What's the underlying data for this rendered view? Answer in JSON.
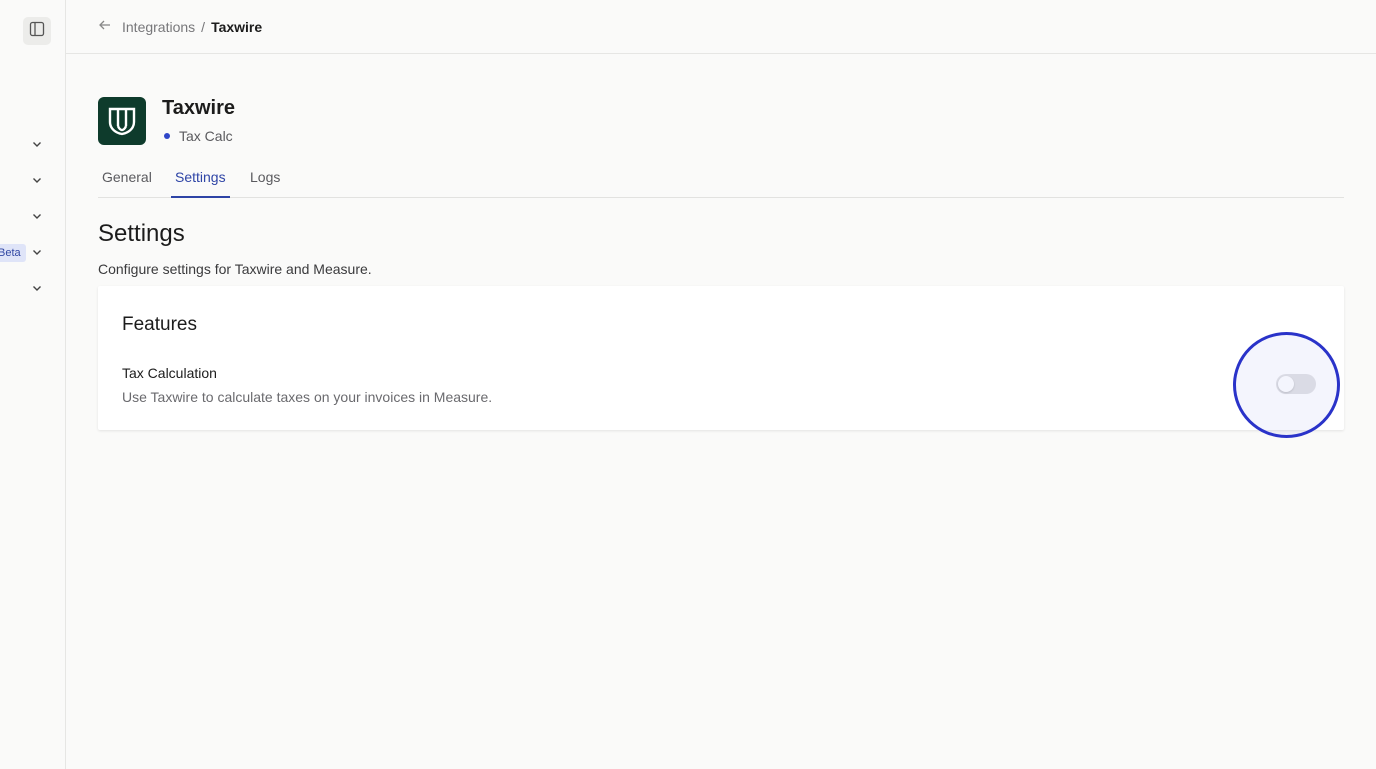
{
  "rail": {
    "toggle_icon": "sidebar-panel-icon",
    "beta_label": "Beta",
    "chevron_icon": "chevron-down-icon"
  },
  "breadcrumb": {
    "back_icon": "arrow-left-icon",
    "parent": "Integrations",
    "separator": "/",
    "current": "Taxwire"
  },
  "header": {
    "title": "Taxwire",
    "subtitle": "Tax Calc",
    "status_dot_color": "#2f46c8",
    "logo_bg": "#0e3b2c"
  },
  "tabs": [
    {
      "label": "General",
      "active": false
    },
    {
      "label": "Settings",
      "active": true
    },
    {
      "label": "Logs",
      "active": false
    }
  ],
  "settings": {
    "heading": "Settings",
    "description": "Configure settings for Taxwire and Measure."
  },
  "features": {
    "title": "Features",
    "items": [
      {
        "name": "Tax Calculation",
        "description": "Use Taxwire to calculate taxes on your invoices in Measure.",
        "enabled": false
      }
    ]
  },
  "colors": {
    "accent": "#2e44a6",
    "highlight_ring": "#2a33c9"
  }
}
